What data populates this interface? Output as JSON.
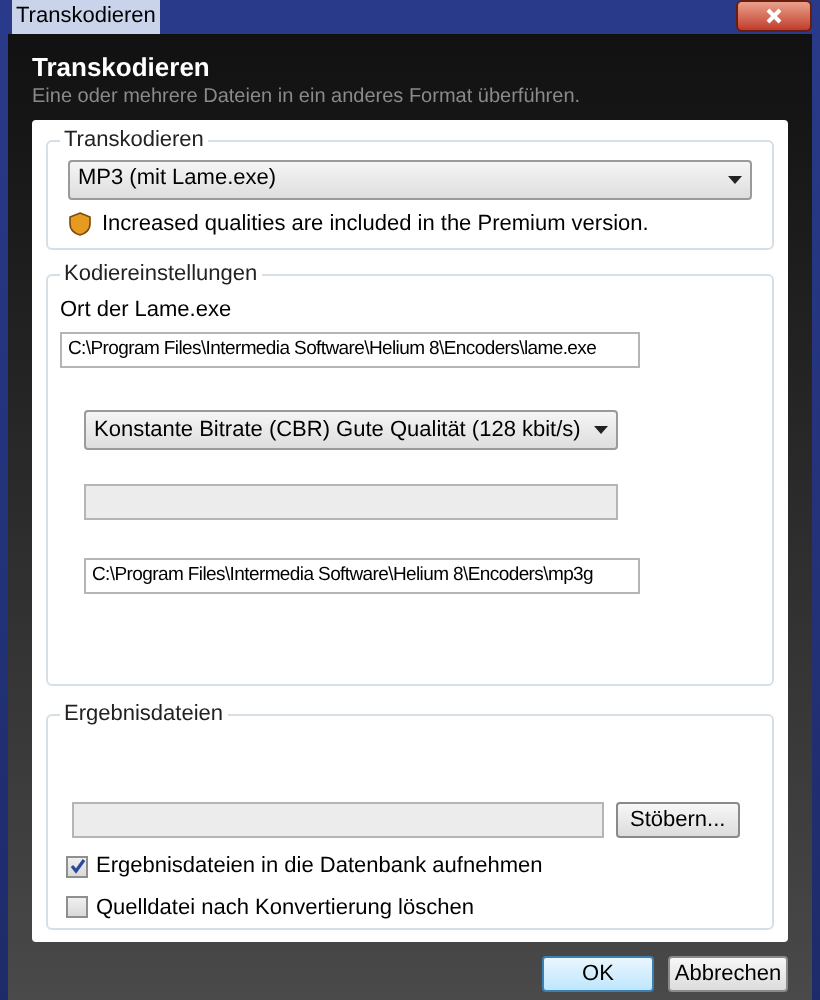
{
  "window": {
    "title": "Transkodieren"
  },
  "header": {
    "title": "Transkodieren",
    "subtitle": "Eine oder mehrere Dateien  in ein anderes Format überführen."
  },
  "transcode": {
    "legend": "Transkodieren",
    "format": "MP3 (mit Lame.exe)",
    "notice": "Increased qualities are included in the Premium version."
  },
  "encoding": {
    "legend": "Kodiereinstellungen",
    "encoder_label": "Ort der Lame.exe",
    "encoder_path": "C:\\Program Files\\Intermedia Software\\Helium 8\\Encoders\\lame.exe",
    "quality": "Konstante Bitrate (CBR) Gute Qualität (128 kbit/s)",
    "field_2_disabled": true,
    "tool_path": "C:\\Program Files\\Intermedia Software\\Helium 8\\Encoders\\mp3g"
  },
  "output": {
    "legend": "Ergebnisdateien",
    "path_disabled": true,
    "browse": "Stöbern...",
    "options": [
      {
        "label": "Ergebnisdateien in die Datenbank aufnehmen",
        "checked": true
      },
      {
        "label": "Quelldatei nach Konvertierung löschen",
        "checked": false
      }
    ]
  },
  "buttons": [
    {
      "label": "OK",
      "default": true
    },
    {
      "label": "Abbrechen",
      "default": false
    }
  ]
}
